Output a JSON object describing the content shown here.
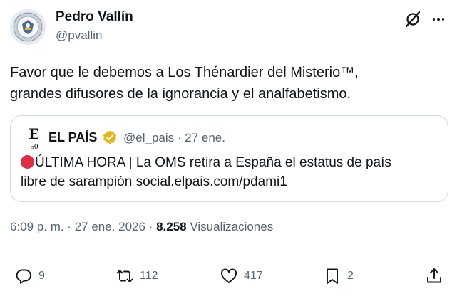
{
  "author": {
    "name": "Pedro Vallín",
    "handle": "@pvallin"
  },
  "tweet": {
    "lines": [
      "Favor que le debemos a Los Thénardier del Misterio™,",
      "grandes difusores de la ignorancia y el analfabetismo."
    ]
  },
  "quote": {
    "logo_letter": "E",
    "logo_number": "50",
    "name": "EL PAÍS",
    "handle_time": "@el_pais · 27 ene.",
    "line1": "ÚLTIMA HORA | La OMS retira a España el estatus de país",
    "line2": "libre de sarampión social.elpais.com/pdami1"
  },
  "meta": {
    "timestamp": "6:09 p. m. · 27 ene. 2026 · ",
    "views_count": "8.258",
    "views_label": " Visualizaciones"
  },
  "actions": {
    "replies": "9",
    "retweets": "112",
    "likes": "417",
    "bookmarks": "2"
  },
  "icons": {
    "grok": "grok-icon",
    "more": "more-icon",
    "verified": "verified-badge-icon",
    "reply": "reply-icon",
    "retweet": "retweet-icon",
    "like": "heart-icon",
    "bookmark": "bookmark-icon",
    "share": "share-icon"
  },
  "colors": {
    "text": "#0f1419",
    "secondary": "#536471",
    "border": "#cfd9de",
    "gold_badge": "#e2b719",
    "red_dot": "#dd2e44"
  }
}
